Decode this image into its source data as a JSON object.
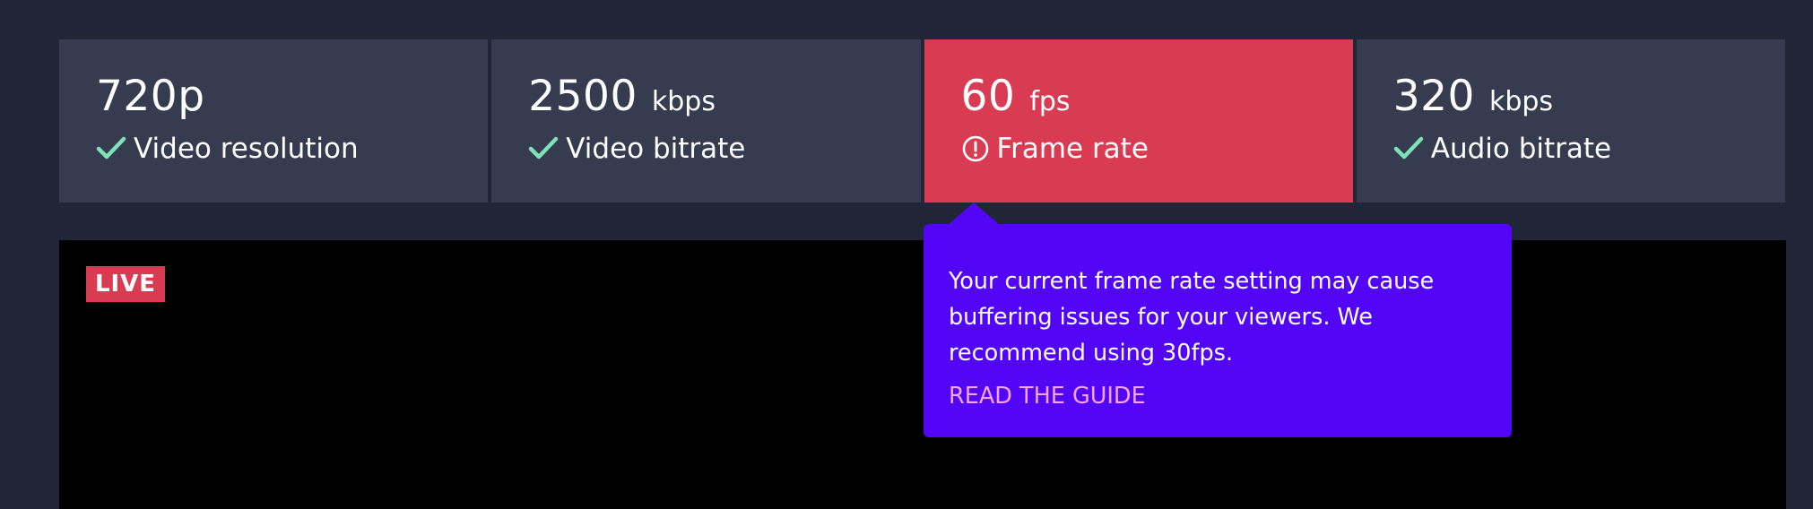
{
  "stats": [
    {
      "value": "720p",
      "unit": "",
      "label": "Video resolution",
      "status": "ok",
      "icon": "check-icon"
    },
    {
      "value": "2500",
      "unit": "kbps",
      "label": "Video bitrate",
      "status": "ok",
      "icon": "check-icon"
    },
    {
      "value": "60",
      "unit": "fps",
      "label": "Frame rate",
      "status": "warning",
      "icon": "alert-circle-icon"
    },
    {
      "value": "320",
      "unit": "kbps",
      "label": "Audio bitrate",
      "status": "ok",
      "icon": "check-icon"
    }
  ],
  "tooltip": {
    "message": "Your current frame rate setting may cause buffering issues for your viewers. We recommend using 30fps.",
    "link_label": "READ THE GUIDE"
  },
  "player": {
    "live_badge": "LIVE"
  },
  "colors": {
    "background": "#202538",
    "card": "#363b4f",
    "alert": "#d93c52",
    "check": "#7ee2b8",
    "tooltip": "#5205f7",
    "link": "#f4a4ea"
  }
}
